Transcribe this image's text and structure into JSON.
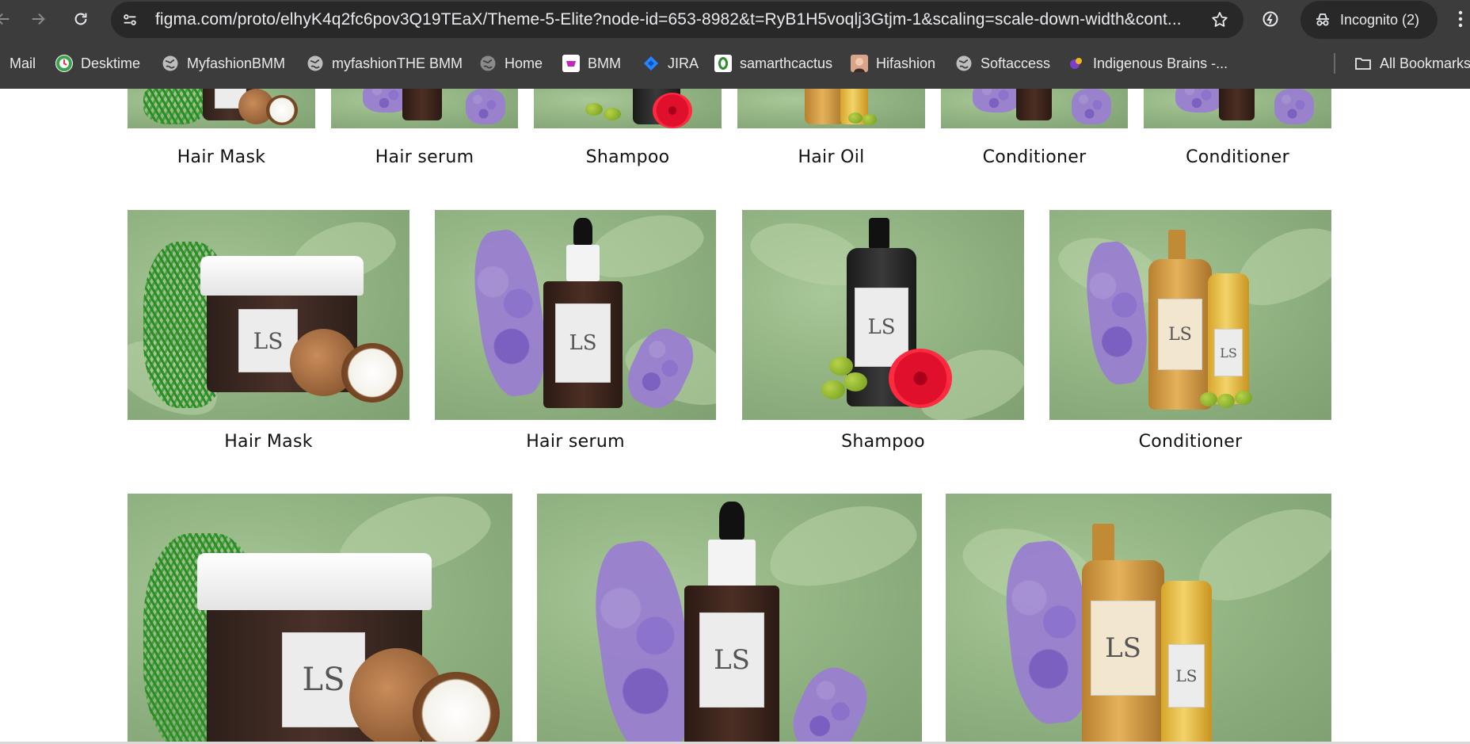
{
  "browser": {
    "url": "figma.com/proto/elhyK4q2fc6pov3Q19TEaX/Theme-5-Elite?node-id=653-8982&t=RyB1H5voqlj3Gtjm-1&scaling=scale-down-width&cont...",
    "incognito_label": "Incognito (2)",
    "bookmarks": [
      {
        "label": "Mail",
        "icon": "mail-icon"
      },
      {
        "label": "Desktime",
        "icon": "desktime-icon"
      },
      {
        "label": "MyfashionBMM",
        "icon": "globe-icon"
      },
      {
        "label": "myfashionTHE BMM",
        "icon": "globe-icon"
      },
      {
        "label": "Home",
        "icon": "globe-icon"
      },
      {
        "label": "BMM",
        "icon": "bmm-icon"
      },
      {
        "label": "JIRA",
        "icon": "jira-icon"
      },
      {
        "label": "samarthcactus",
        "icon": "cactus-icon"
      },
      {
        "label": "Hifashion",
        "icon": "hifashion-icon"
      },
      {
        "label": "Softaccess",
        "icon": "globe-icon"
      },
      {
        "label": "Indigenous Brains -...",
        "icon": "indigenous-icon"
      }
    ],
    "all_bookmarks_label": "All Bookmarks"
  },
  "rows": {
    "row1": [
      "Hair Mask",
      "Hair serum",
      "Shampoo",
      "Hair Oil",
      "Conditioner",
      "Conditioner"
    ],
    "row2": [
      "Hair Mask",
      "Hair serum",
      "Shampoo",
      "Conditioner"
    ],
    "row3": []
  },
  "colors": {
    "chrome_bg": "#3c3c3c",
    "omnibox_bg": "#282828",
    "chrome_text": "#e8eaed",
    "label_text": "#111111"
  }
}
